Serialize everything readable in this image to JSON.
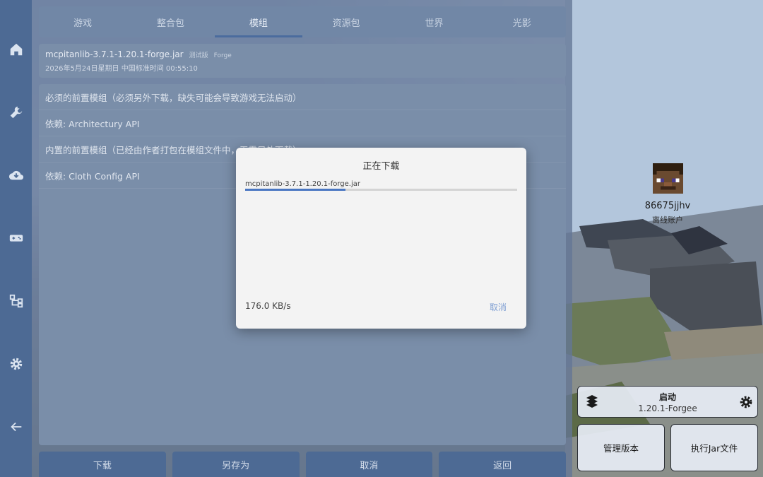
{
  "tabs": [
    {
      "label": "游戏",
      "active": false
    },
    {
      "label": "整合包",
      "active": false
    },
    {
      "label": "模组",
      "active": true
    },
    {
      "label": "资源包",
      "active": false
    },
    {
      "label": "世界",
      "active": false
    },
    {
      "label": "光影",
      "active": false
    }
  ],
  "mod": {
    "name": "mcpitanlib-3.7.1-1.20.1-forge.jar",
    "tag_release": "测试版",
    "tag_loader": "Forge",
    "date": "2026年5月24日星期日 中国标准时间 00:55:10"
  },
  "dependencies": [
    "必须的前置模组（必须另外下载，缺失可能会导致游戏无法启动）",
    "依赖: Architectury API",
    "内置的前置模组（已经由作者打包在模组文件中，无需另外下载）",
    "依赖: Cloth Config API"
  ],
  "bottom_buttons": [
    "下载",
    "另存为",
    "取消",
    "返回"
  ],
  "rail_icons": [
    "home-icon",
    "wrench-icon",
    "cloud-download-icon",
    "gamepad-icon",
    "tree-icon",
    "gear-icon",
    "back-arrow-icon"
  ],
  "account": {
    "username": "86675jjhv",
    "type": "离线账户"
  },
  "launch": {
    "title": "启动",
    "version": "1.20.1-Forgee"
  },
  "side_buttons": {
    "manage": "管理版本",
    "run_jar": "执行Jar文件"
  },
  "dialog": {
    "title": "正在下载",
    "file": "mcpitanlib-3.7.1-1.20.1-forge.jar",
    "progress": 0.37,
    "speed": "176.0 KB/s",
    "cancel": "取消"
  },
  "colors": {
    "rail": "#4d6a94",
    "accent": "#4a77c2",
    "cancel_link": "#7f9fd3"
  }
}
